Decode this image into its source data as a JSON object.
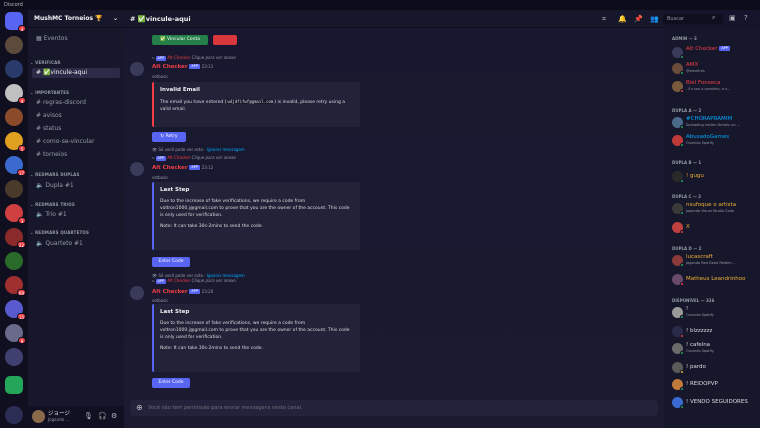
{
  "app": {
    "title": "Discord"
  },
  "guild": {
    "name": "MushMC Torneios 🏆"
  },
  "channel": {
    "title": "✅vincule-aqui"
  },
  "sidebar": {
    "events": "Eventos",
    "categories": [
      "VERIFICAR",
      "IMPORTANTES",
      "REDMARS DUPLAS",
      "REDMARS TRIOS",
      "REDMARS QUARTETOS"
    ],
    "channels": [
      "✅vincule-aqui",
      "regras-discord",
      "avisos",
      "status",
      "como-se-vincular",
      "torneios"
    ],
    "voice": [
      "Dupla #1",
      "Trio #1",
      "Quarteto #1"
    ],
    "badges": [
      "4",
      "4",
      "5",
      "17",
      "3",
      "22",
      "69",
      "15",
      "9"
    ]
  },
  "user": {
    "name": "ジョージ",
    "status": "Jogando ..."
  },
  "topbar": {
    "search_placeholder": "Buscar"
  },
  "messages": [
    {
      "reply_name": "Alt Checker",
      "reply_text": "Clique para ver anexo",
      "author": "Alt Checker",
      "tag": "APP",
      "time": "23:11",
      "sub": "setbasic",
      "embed_title": "Invalid Email",
      "embed_text_1": "The email you have entered (",
      "embed_code": "wdjdfifwf@gmail.com",
      "embed_text_2": ") is invalid, please retry using a valid email.",
      "button": "Retry",
      "eph": "Só você pode ver esta ·",
      "eph_link": "Ignorar mensagem"
    },
    {
      "reply_name": "Alt Checker",
      "reply_text": "Clique para ver anexo",
      "author": "Alt Checker",
      "tag": "APP",
      "time": "23:12",
      "sub": "setbasic",
      "embed_title": "Last Step",
      "embed_p1": "Due to the increase of fake verifications, we require a code from voltron1000.j@gmail.com to prove that you are the owner of the account. This code is only used for verification.",
      "embed_note": "Note: It can take 30s-2mins to send the code.",
      "button": "Enter Code",
      "eph": "Só você pode ver esta ·",
      "eph_link": "Ignorar mensagem"
    },
    {
      "reply_name": "Alt Checker",
      "reply_text": "Clique para ver anexo",
      "author": "Alt Checker",
      "tag": "APP",
      "time": "23:20",
      "sub": "setbasic",
      "embed_title": "Last Step",
      "embed_p1": "Due to the increase of fake verifications, we require a code from voltron1000.j@gmail.com to prove that you are the owner of the account. This code is only used for verification.",
      "embed_note": "Note: It can take 30s-2mins to send the code.",
      "button": "Enter Code",
      "eph": "Só você pode ver esta ·",
      "eph_link": "Ignorar mensagem"
    }
  ],
  "top_buttons": {
    "verify": "✅ Vincular Conta"
  },
  "composer": {
    "placeholder": "Você não tem permissão para enviar mensagens neste canal."
  },
  "members": {
    "categories": [
      "ADMIN — 3",
      "DUPLA A — 2",
      "DUPLA B — 1",
      "DUPLA C — 2",
      "DUPLA D — 2",
      "DISPONÍVEL — 326"
    ],
    "list": [
      {
        "name": "Alt Checker",
        "status": "",
        "color": "#f23f43",
        "tag": "APP"
      },
      {
        "name": "AMX",
        "status": "@amxfires",
        "color": "#f23f43"
      },
      {
        "name": "Biel Fonseca",
        "status": "- Eu sou o caminho, a v...",
        "color": "#f23f43"
      },
      {
        "name": "#CHORAPRAMIM",
        "status": "Spreading smiles literally on ...",
        "color": "#00a8fc"
      },
      {
        "name": "AbusadoGames",
        "status": "Ouvindo Spotify",
        "color": "#00a8fc"
      },
      {
        "name": "! gugu",
        "status": "",
        "color": "#f0b232"
      },
      {
        "name": "nsufoque o artista",
        "status": "Jogando Visual Studio Code",
        "color": "#f0b232"
      },
      {
        "name": "X",
        "status": "",
        "color": "#f0b232"
      },
      {
        "name": "lucascraft",
        "status": "Jogando Red Dead Redem...",
        "color": "#f0b232"
      },
      {
        "name": "Matheus Leandrinhoo",
        "status": "",
        "color": "#f0b232"
      },
      {
        "name": "!",
        "status": "Ouvindo Spotify",
        "color": "#dbdee1"
      },
      {
        "name": "! blzzzzzz",
        "status": "",
        "color": "#dbdee1"
      },
      {
        "name": "! cafeína",
        "status": "Ouvindo Spotify",
        "color": "#dbdee1"
      },
      {
        "name": "! pardo",
        "status": "",
        "color": "#dbdee1"
      },
      {
        "name": "! REIDOPVP",
        "status": "",
        "color": "#dbdee1"
      },
      {
        "name": "! VENDO SEGUIDORES",
        "status": "",
        "color": "#dbdee1"
      }
    ]
  }
}
